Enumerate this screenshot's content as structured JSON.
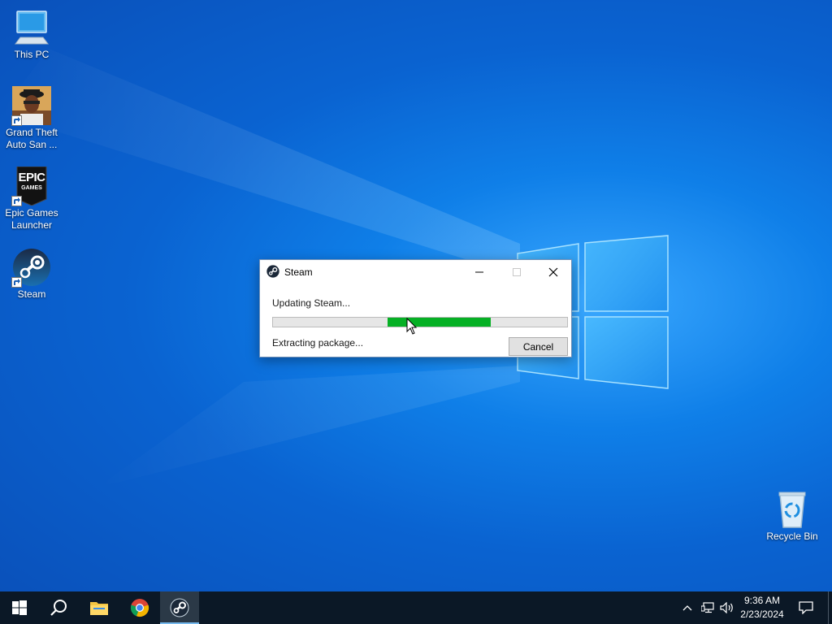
{
  "desktop": {
    "icons": [
      {
        "label_line1": "This PC",
        "label_line2": ""
      },
      {
        "label_line1": "Grand Theft",
        "label_line2": "Auto San ..."
      },
      {
        "label_line1": "Epic Games",
        "label_line2": "Launcher"
      },
      {
        "label_line1": "Steam",
        "label_line2": ""
      },
      {
        "label_line1": "Recycle Bin",
        "label_line2": ""
      }
    ],
    "epic_logo": {
      "line1": "EPIC",
      "line2": "GAMES"
    }
  },
  "dialog": {
    "title": "Steam",
    "status": "Updating Steam...",
    "detail": "Extracting package...",
    "cancel_label": "Cancel",
    "progress": {
      "start": 0.39,
      "end": 0.74,
      "color": "#06b025"
    }
  },
  "taskbar": {
    "apps": [
      "start-icon",
      "search-icon",
      "file-explorer-icon",
      "chrome-icon",
      "steam-icon"
    ],
    "active_app": "steam-icon",
    "clock": {
      "time": "9:36 AM",
      "date": "2/23/2024"
    }
  },
  "colors": {
    "taskbar": "#0b1826",
    "accent": "#76b9ed",
    "progress": "#06b025"
  }
}
